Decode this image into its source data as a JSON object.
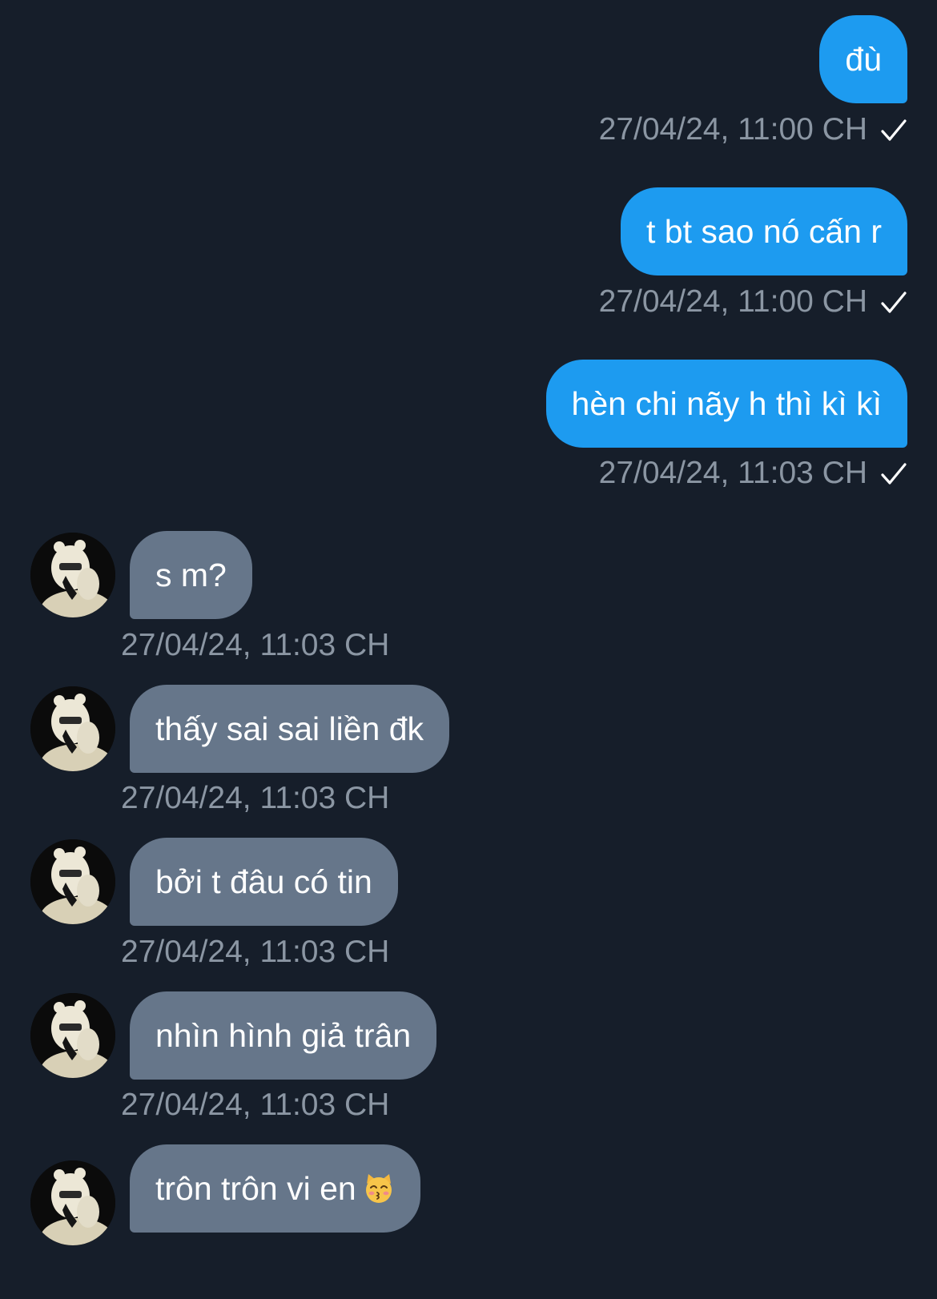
{
  "colors": {
    "background": "#161e2a",
    "outgoing_bubble": "#1d9bf0",
    "incoming_bubble": "#66768a",
    "meta_text": "#8b96a3"
  },
  "messages": [
    {
      "direction": "outgoing",
      "text": "đù",
      "timestamp": "27/04/24, 11:00 CH",
      "status_icon": "checkmark-icon"
    },
    {
      "direction": "outgoing",
      "text": "t bt sao nó cấn r",
      "timestamp": "27/04/24, 11:00 CH",
      "status_icon": "checkmark-icon"
    },
    {
      "direction": "outgoing",
      "text": "hèn chi nãy h thì kì kì",
      "timestamp": "27/04/24, 11:03 CH",
      "status_icon": "checkmark-icon"
    },
    {
      "direction": "incoming",
      "text": "s m?",
      "timestamp": "27/04/24, 11:03 CH"
    },
    {
      "direction": "incoming",
      "text": "thấy sai sai liền đk",
      "timestamp": "27/04/24, 11:03 CH"
    },
    {
      "direction": "incoming",
      "text": "bởi t đâu có tin",
      "timestamp": "27/04/24, 11:03 CH"
    },
    {
      "direction": "incoming",
      "text": "nhìn hình giả trân",
      "timestamp": "27/04/24, 11:03 CH"
    },
    {
      "direction": "incoming",
      "text": "trôn trôn vi en",
      "emoji_icon": "kissing-cat-emoji-icon"
    }
  ]
}
